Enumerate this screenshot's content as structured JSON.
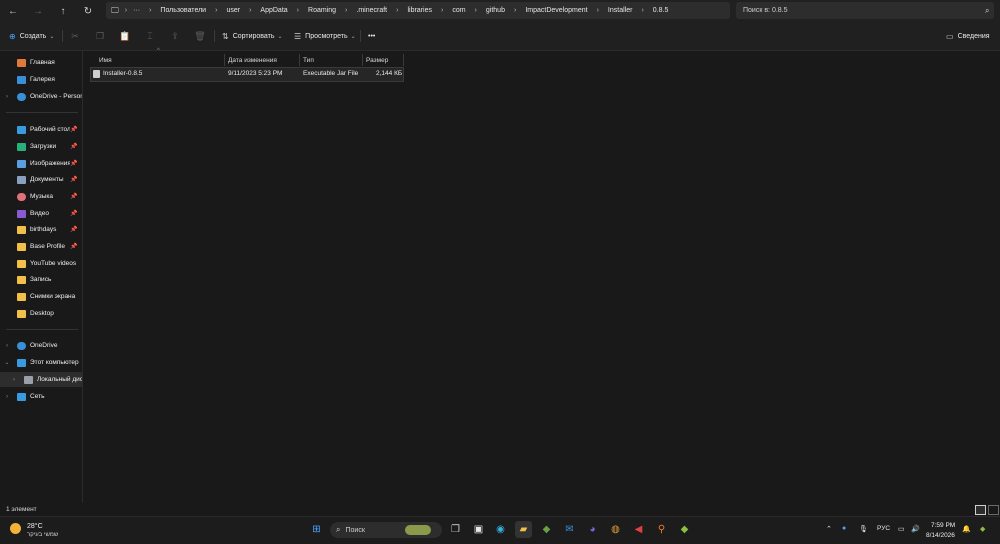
{
  "address": {
    "crumbs": [
      "Пользователи",
      "user",
      "AppData",
      "Roaming",
      ".minecraft",
      "libraries",
      "com",
      "github",
      "ImpactDevelopment",
      "Installer",
      "0.8.5"
    ],
    "search_placeholder": "Поиск в: 0.8.5"
  },
  "toolbar": {
    "create_label": "Создать",
    "sort_label": "Сортировать",
    "view_label": "Просмотреть",
    "more_label": "•••",
    "details_label": "Сведения"
  },
  "sidebar": {
    "top": [
      {
        "label": "Главная",
        "icon": "home-icon",
        "color": "#e07a3a"
      },
      {
        "label": "Галерея",
        "icon": "gallery-icon",
        "color": "#3a8fd9"
      },
      {
        "label": "OneDrive - Persona",
        "icon": "cloud-icon",
        "color": "#3a8fd9"
      }
    ],
    "quick": [
      {
        "label": "Рабочий стол",
        "icon": "desktop-icon",
        "color": "#3a9ae0",
        "pinned": true
      },
      {
        "label": "Загрузки",
        "icon": "download-icon",
        "color": "#27b07a",
        "pinned": true
      },
      {
        "label": "Изображения",
        "icon": "images-icon",
        "color": "#5aa0e0",
        "pinned": true
      },
      {
        "label": "Документы",
        "icon": "documents-icon",
        "color": "#8aa0c0",
        "pinned": true
      },
      {
        "label": "Музыка",
        "icon": "music-icon",
        "color": "#e0707a",
        "pinned": true
      },
      {
        "label": "Видео",
        "icon": "video-icon",
        "color": "#8a5ad0",
        "pinned": true
      },
      {
        "label": "birthdays",
        "icon": "folder-icon",
        "color": "#f2c04a",
        "pinned": true
      },
      {
        "label": "Base Profile",
        "icon": "folder-icon",
        "color": "#f2c04a",
        "pinned": true
      },
      {
        "label": "YouTube videos",
        "icon": "folder-icon",
        "color": "#f2c04a",
        "pinned": false
      },
      {
        "label": "Запись",
        "icon": "folder-icon",
        "color": "#f2c04a",
        "pinned": false
      },
      {
        "label": "Снимки экрана",
        "icon": "folder-icon",
        "color": "#f2c04a",
        "pinned": false
      },
      {
        "label": "Desktop",
        "icon": "folder-icon",
        "color": "#f2c04a",
        "pinned": false
      }
    ],
    "tree": [
      {
        "label": "OneDrive",
        "icon": "cloud-icon",
        "color": "#3a8fd9",
        "chevron": "›"
      },
      {
        "label": "Этот компьютер",
        "icon": "computer-icon",
        "color": "#3a9ae0",
        "chevron": "⌄"
      },
      {
        "label": "Локальный диск",
        "icon": "drive-icon",
        "color": "#9aa0a8",
        "chevron": "›"
      },
      {
        "label": "Сеть",
        "icon": "network-icon",
        "color": "#3a9ae0",
        "chevron": "›"
      }
    ]
  },
  "columns": {
    "name": "Имя",
    "date": "Дата изменения",
    "type": "Тип",
    "size": "Размер"
  },
  "files": [
    {
      "name": "Installer-0.8.5",
      "date": "9/11/2023 5:23 PM",
      "type": "Executable Jar File",
      "size": "2,144 КБ"
    }
  ],
  "status": {
    "count": "1 элемент"
  },
  "taskbar": {
    "weather_temp": "28°C",
    "weather_desc": "שמשי בעיקר",
    "search_placeholder": "Поиск",
    "lang": "РУС",
    "time": "7:59 PM",
    "date": "8/14/2026"
  }
}
